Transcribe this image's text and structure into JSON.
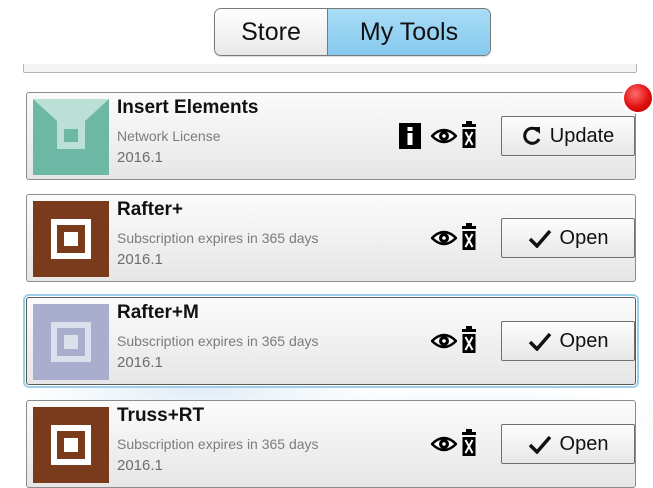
{
  "tabs": {
    "store": "Store",
    "my_tools": "My Tools",
    "selected": "My Tools"
  },
  "items": [
    {
      "title": "Insert Elements",
      "subtitle": "Network License",
      "version": "2016.1",
      "action": "Update",
      "action_icon": "refresh-icon",
      "thumb_color": "#6cb8a5",
      "has_info": true,
      "has_notification": true
    },
    {
      "title": "Rafter+",
      "subtitle": "Subscription expires in 365 days",
      "version": "2016.1",
      "action": "Open",
      "action_icon": "checkmark-icon",
      "thumb_color": "#7a3b1c",
      "has_info": false
    },
    {
      "title": "Rafter+M",
      "subtitle": "Subscription expires in 365 days",
      "version": "2016.1",
      "action": "Open",
      "action_icon": "checkmark-icon",
      "thumb_color": "#a9aecf",
      "has_info": false,
      "selected": true
    },
    {
      "title": "Truss+RT",
      "subtitle": "Subscription expires in 365 days",
      "version": "2016.1",
      "action": "Open",
      "action_icon": "checkmark-icon",
      "thumb_color": "#7a3b1c",
      "has_info": false
    }
  ]
}
